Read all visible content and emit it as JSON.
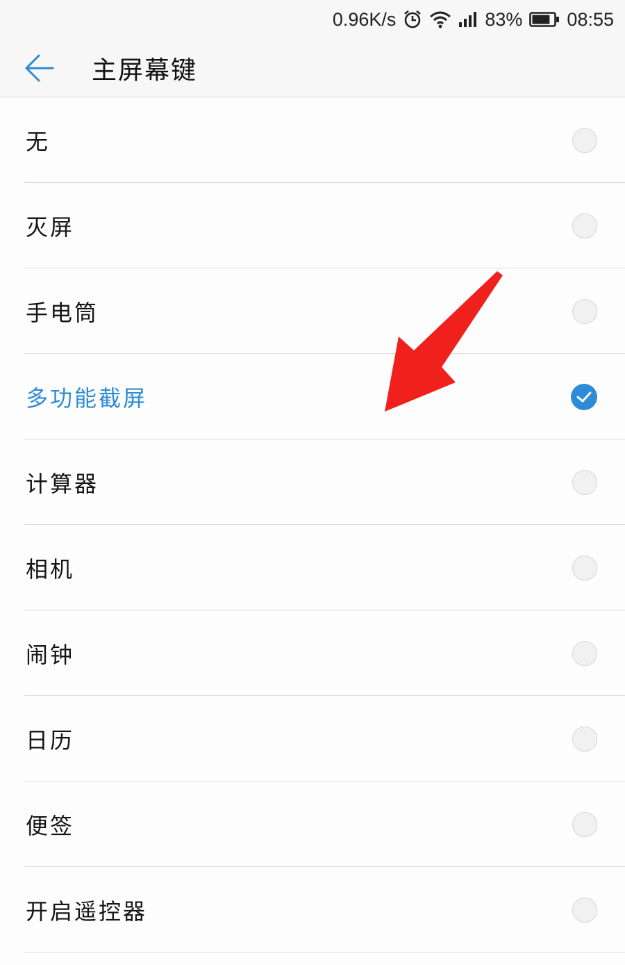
{
  "status_bar": {
    "network_speed": "0.96K/s",
    "battery_percent": "83%",
    "battery_level": 0.83,
    "time": "08:55",
    "icons": [
      "alarm-icon",
      "wifi-icon",
      "signal-icon",
      "battery-icon"
    ]
  },
  "header": {
    "back_icon": "arrow-left-icon",
    "title": "主屏幕键"
  },
  "options": [
    {
      "label": "无",
      "selected": false
    },
    {
      "label": "灭屏",
      "selected": false
    },
    {
      "label": "手电筒",
      "selected": false
    },
    {
      "label": "多功能截屏",
      "selected": true
    },
    {
      "label": "计算器",
      "selected": false
    },
    {
      "label": "相机",
      "selected": false
    },
    {
      "label": "闹钟",
      "selected": false
    },
    {
      "label": "日历",
      "selected": false
    },
    {
      "label": "便签",
      "selected": false
    },
    {
      "label": "开启遥控器",
      "selected": false
    }
  ],
  "colors": {
    "accent": "#2e8bd6",
    "annotation": "#f0201c",
    "divider": "#dcdcdc"
  }
}
